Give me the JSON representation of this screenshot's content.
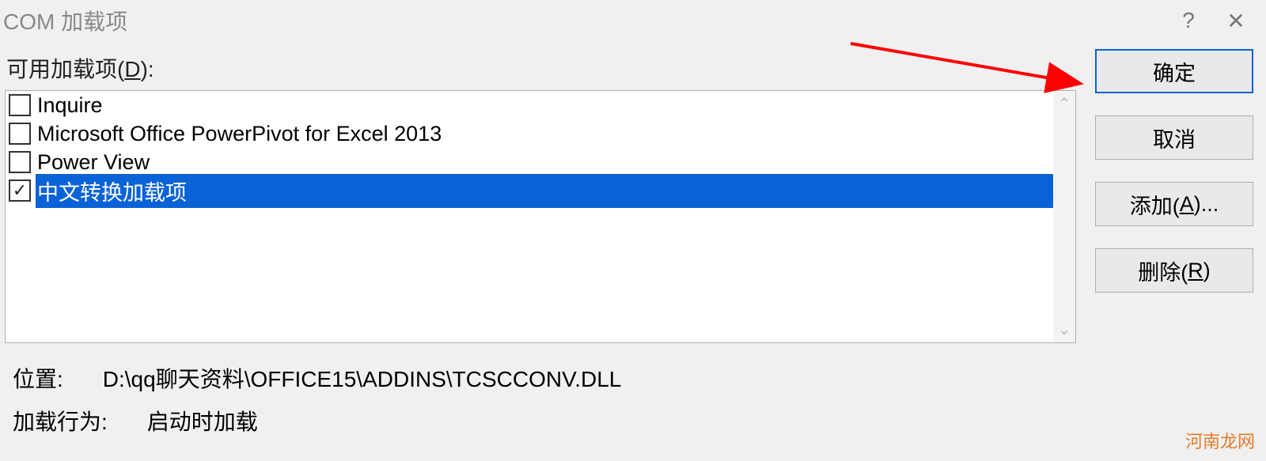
{
  "window": {
    "title": "COM 加载项",
    "help_icon": "?",
    "close_icon": "✕"
  },
  "section": {
    "label_prefix": "可用加载项(",
    "label_hotkey": "D",
    "label_suffix": "):"
  },
  "items": [
    {
      "label": "Inquire",
      "checked": false,
      "selected": false
    },
    {
      "label": "Microsoft Office PowerPivot for Excel 2013",
      "checked": false,
      "selected": false
    },
    {
      "label": "Power View",
      "checked": false,
      "selected": false
    },
    {
      "label": "中文转换加载项",
      "checked": true,
      "selected": true
    }
  ],
  "buttons": {
    "ok": "确定",
    "cancel": "取消",
    "add_prefix": "添加(",
    "add_hotkey": "A",
    "add_suffix": ")...",
    "remove_prefix": "删除(",
    "remove_hotkey": "R",
    "remove_suffix": ")"
  },
  "info": {
    "location_label": "位置:",
    "location_value": "D:\\qq聊天资料\\OFFICE15\\ADDINS\\TCSCCONV.DLL",
    "behavior_label": "加载行为:",
    "behavior_value": "启动时加载"
  },
  "watermark": "河南龙网"
}
